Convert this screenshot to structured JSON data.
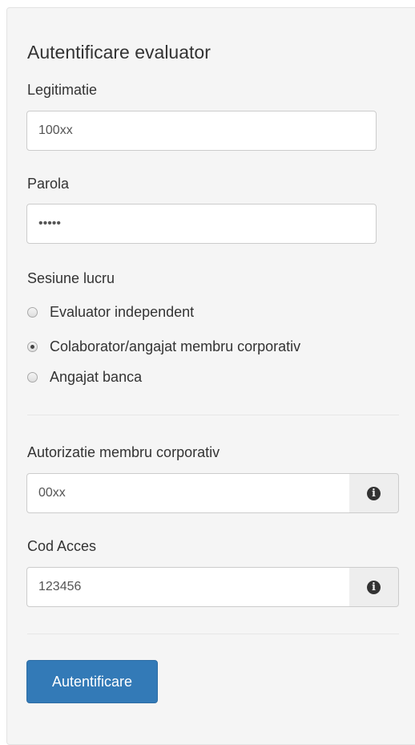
{
  "form": {
    "title": "Autentificare evaluator",
    "legitimatie": {
      "label": "Legitimatie",
      "value": "100xx"
    },
    "parola": {
      "label": "Parola",
      "value": "•••••"
    },
    "sesiune": {
      "label": "Sesiune lucru",
      "options": [
        {
          "label": "Evaluator independent",
          "checked": false
        },
        {
          "label": "Colaborator/angajat membru corporativ",
          "checked": true
        },
        {
          "label": "Angajat banca",
          "checked": false
        }
      ]
    },
    "autorizatie": {
      "label": "Autorizatie membru corporativ",
      "value": "00xx",
      "addon_icon": "info-circle-icon"
    },
    "cod_acces": {
      "label": "Cod Acces",
      "value": "123456",
      "addon_icon": "info-circle-icon"
    },
    "submit_label": "Autentificare"
  },
  "colors": {
    "panel_bg": "#f5f5f5",
    "primary": "#337ab7",
    "addon_bg": "#eeeeee"
  }
}
